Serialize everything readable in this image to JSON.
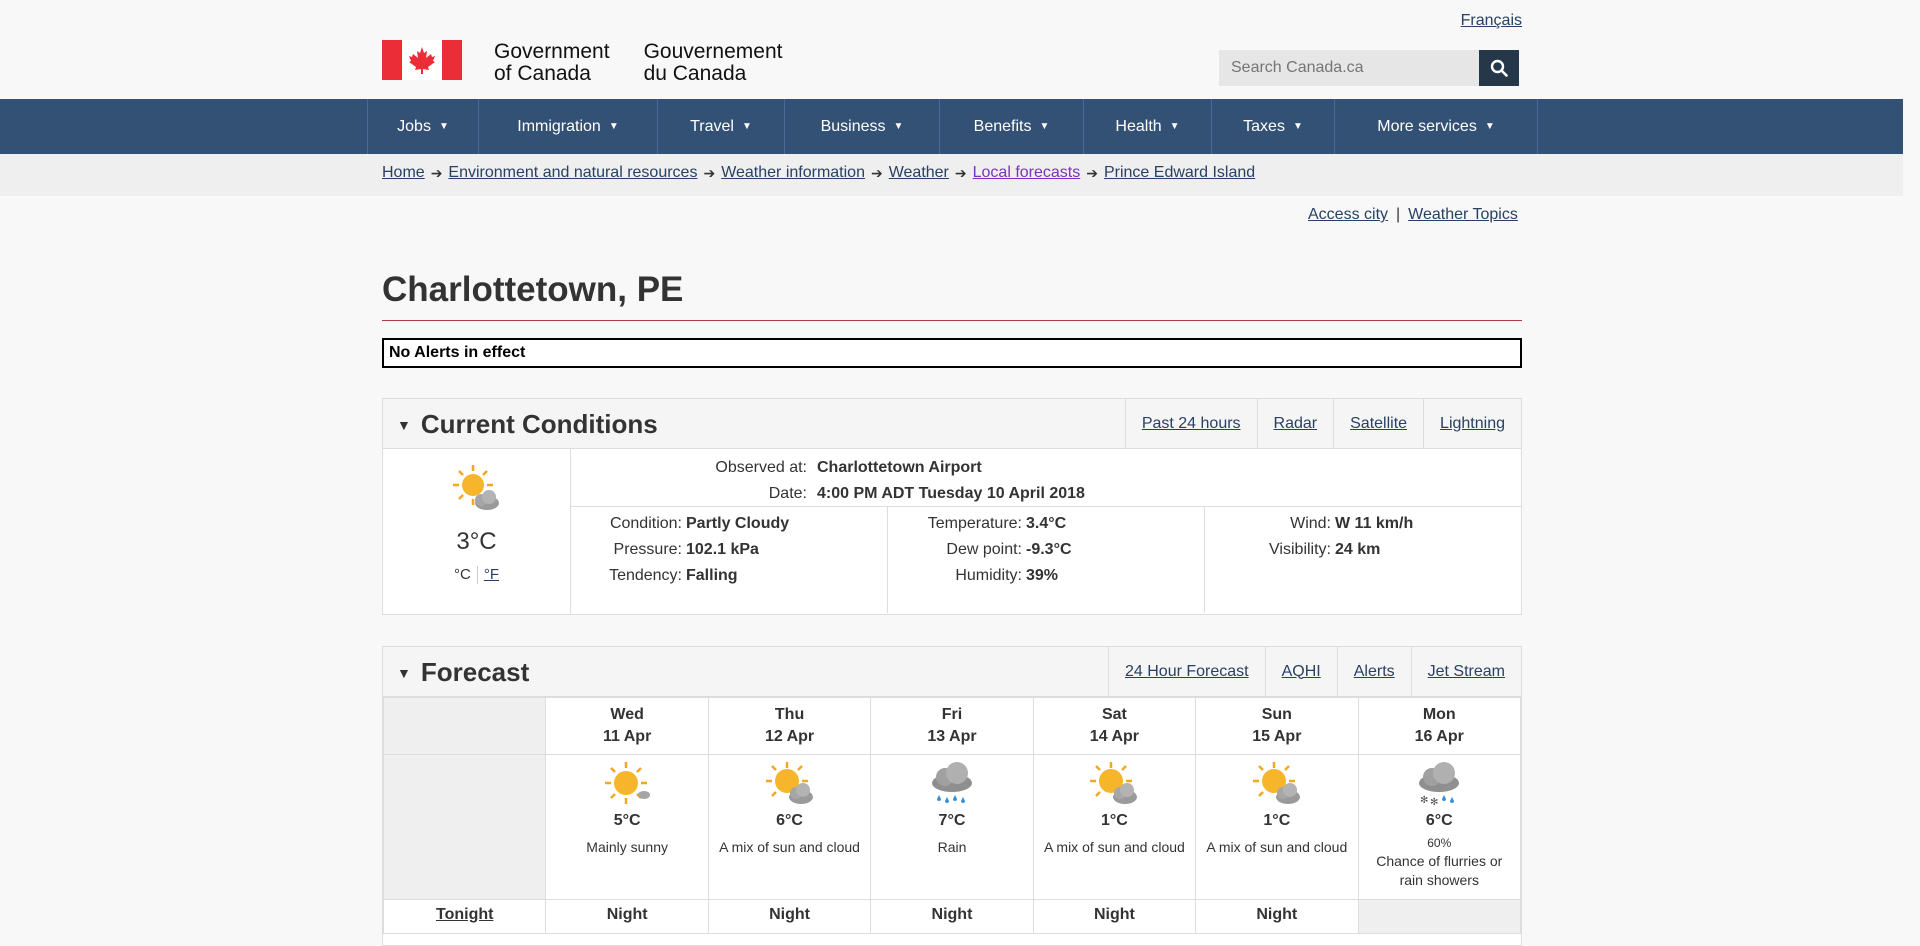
{
  "header": {
    "lang_link": "Français",
    "gov_en_1": "Government",
    "gov_en_2": "of Canada",
    "gov_fr_1": "Gouvernement",
    "gov_fr_2": "du Canada",
    "search_placeholder": "Search Canada.ca"
  },
  "menu": [
    {
      "label": "Jobs"
    },
    {
      "label": "Immigration"
    },
    {
      "label": "Travel"
    },
    {
      "label": "Business"
    },
    {
      "label": "Benefits"
    },
    {
      "label": "Health"
    },
    {
      "label": "Taxes"
    },
    {
      "label": "More services"
    }
  ],
  "breadcrumb": [
    "Home",
    "Environment and natural resources",
    "Weather information",
    "Weather",
    "Local forecasts",
    "Prince Edward Island"
  ],
  "toplinks": {
    "access_city": "Access city",
    "sep": "|",
    "weather_topics": "Weather Topics"
  },
  "page_title": "Charlottetown, PE",
  "alerts_text": "No Alerts in effect",
  "current": {
    "heading": "Current Conditions",
    "tabs": [
      "Past 24 hours",
      "Radar",
      "Satellite",
      "Lightning"
    ],
    "temp": "3°C",
    "unit_c": "°C",
    "unit_f": "°F",
    "observed_label": "Observed at:",
    "observed_value": "Charlottetown Airport",
    "date_label": "Date:",
    "date_value": "4:00 PM ADT Tuesday 10 April 2018",
    "condition_label": "Condition:",
    "condition_value": "Partly Cloudy",
    "pressure_label": "Pressure:",
    "pressure_value": "102.1 kPa",
    "tendency_label": "Tendency:",
    "tendency_value": "Falling",
    "temperature_label": "Temperature:",
    "temperature_value": "3.4°C",
    "dewpoint_label": "Dew point:",
    "dewpoint_value": "-9.3°C",
    "humidity_label": "Humidity:",
    "humidity_value": "39%",
    "wind_label": "Wind:",
    "wind_value": "W 11 km/h",
    "visibility_label": "Visibility:",
    "visibility_value": "24 km"
  },
  "forecast": {
    "heading": "Forecast",
    "tabs": [
      "24 Hour Forecast",
      "AQHI",
      "Alerts",
      "Jet Stream"
    ],
    "tonight_label": "Tonight",
    "days": [
      {
        "dow": "Wed",
        "date": "11 Apr",
        "icon": "sun-icon",
        "temp": "5°C",
        "pop": "",
        "desc": "Mainly sunny",
        "night": "Night"
      },
      {
        "dow": "Thu",
        "date": "12 Apr",
        "icon": "sun-cloud-icon",
        "temp": "6°C",
        "pop": "",
        "desc": "A mix of sun and cloud",
        "night": "Night"
      },
      {
        "dow": "Fri",
        "date": "13 Apr",
        "icon": "rain-icon",
        "temp": "7°C",
        "pop": "",
        "desc": "Rain",
        "night": "Night"
      },
      {
        "dow": "Sat",
        "date": "14 Apr",
        "icon": "sun-cloud-icon",
        "temp": "1°C",
        "pop": "",
        "desc": "A mix of sun and cloud",
        "night": "Night"
      },
      {
        "dow": "Sun",
        "date": "15 Apr",
        "icon": "sun-cloud-icon",
        "temp": "1°C",
        "pop": "",
        "desc": "A mix of sun and cloud",
        "night": "Night"
      },
      {
        "dow": "Mon",
        "date": "16 Apr",
        "icon": "snow-rain-icon",
        "temp": "6°C",
        "pop": "60%",
        "desc": "Chance of flurries or rain showers",
        "night": ""
      }
    ]
  },
  "colors": {
    "menu_bg": "#335075",
    "flag_red": "#eb2d37",
    "link": "#284162",
    "visited": "#7834bc"
  }
}
